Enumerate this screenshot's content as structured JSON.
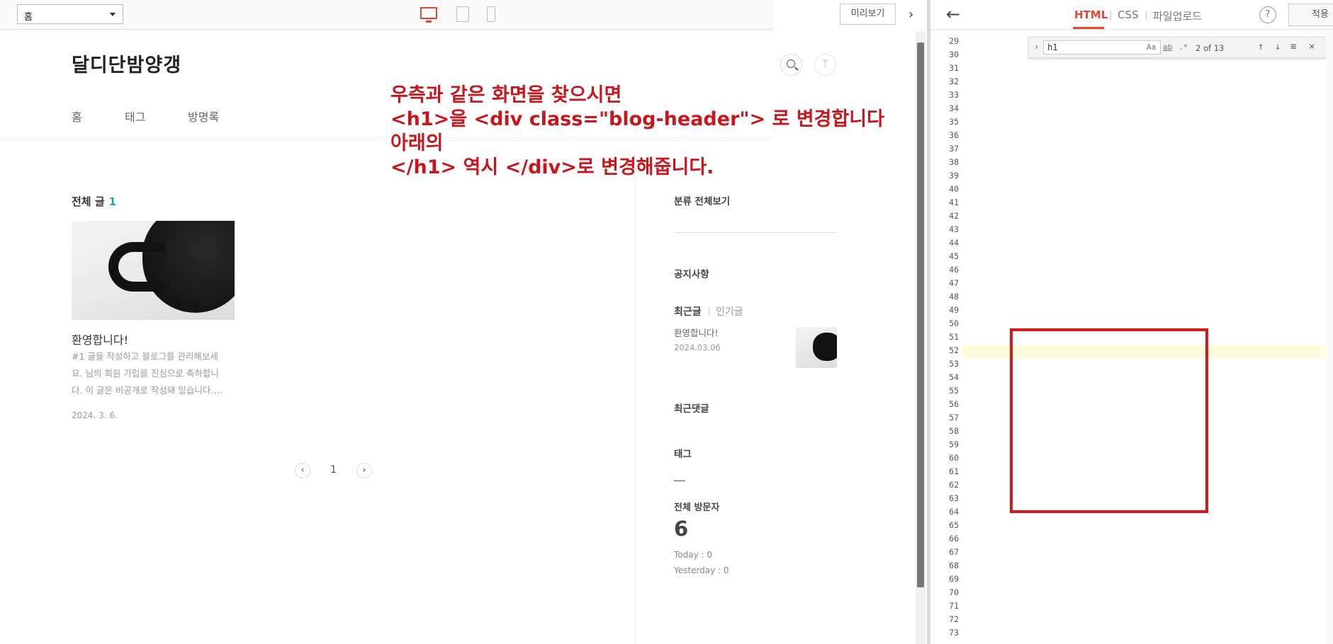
{
  "editor_top": {
    "page_select": "홈",
    "preview_label": "미리보기"
  },
  "blog": {
    "title": "달디단밤양갱",
    "nav": [
      "홈",
      "태그",
      "방명록"
    ],
    "all_posts_label": "전체 글",
    "all_posts_count": "1",
    "post": {
      "title": "환영합니다!",
      "excerpt": "#1 글을 작성하고 블로그를 관리해보세요. 님의 회원 가입을 진심으로 축하합니다. 이 글은 비공개로 작성돼 있습니다.…",
      "date": "2024. 3. 6."
    },
    "pagination": {
      "prev": "‹",
      "current": "1",
      "next": "›"
    },
    "sidebar": {
      "category_all": "분류 전체보기",
      "notice": "공지사항",
      "tab_recent": "최근글",
      "tab_popular": "인기글",
      "recent_title": "환영합니다!",
      "recent_date": "2024.03.06",
      "recent_comments": "최근댓글",
      "tags": "태그",
      "visitors_label": "전체 방문자",
      "visitors_total": "6",
      "today": "Today : 0",
      "yesterday": "Yesterday : 0"
    }
  },
  "annotation": [
    "우측과 같은 화면을 찾으시면",
    "<h1>을  <div class=\"blog-header\"> 로 변경합니다",
    "아래의",
    "</h1> 역시 </div>로 변경해줍니다."
  ],
  "code_editor": {
    "tabs": [
      "HTML",
      "CSS",
      "파일업로드"
    ],
    "help": "?",
    "apply": "적용",
    "find": {
      "query": "h1",
      "count": "2 of 13",
      "opt_case": "Aa",
      "opt_word": "ab",
      "opt_regex": ".*"
    },
    "line_numbers": [
      "29",
      "30",
      "31",
      "32",
      "33",
      "34",
      "35",
      "36",
      "37",
      "38",
      "39",
      "40",
      "41",
      "42",
      "43",
      "44",
      "45",
      "46",
      "47",
      "48",
      "49",
      "50",
      "51",
      "52",
      "53",
      "54",
      "55",
      "56",
      "57",
      "58",
      "59",
      "60",
      "61",
      "62",
      "63",
      "64",
      "65",
      "66",
      "67",
      "68",
      "69",
      "70",
      "71",
      "72",
      "73"
    ]
  },
  "colors": {
    "accent": "#e04a2f",
    "annotation": "#c8161d",
    "highlight_box": "#e01616",
    "count": "#22a2b8"
  }
}
